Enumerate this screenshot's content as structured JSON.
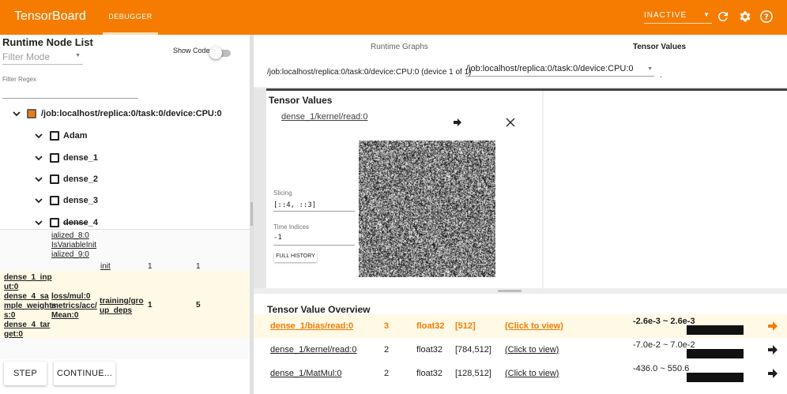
{
  "header": {
    "brand": "TensorBoard",
    "tab": "DEBUGGER",
    "status": "INACTIVE"
  },
  "left": {
    "title": "Runtime Node List",
    "filter_mode_placeholder": "Filter Mode",
    "show_code_label": "Show Code:",
    "filter_regex_label": "Filter Regex",
    "device_node": "/job:localhost/replica:0/task:0/device:CPU:0",
    "nodes": [
      "Adam",
      "dense_1",
      "dense_2",
      "dense_3",
      "dense_4"
    ],
    "partial_lines": [
      "ialized_8:0",
      "IsVariableInit",
      "ialized_9:0"
    ],
    "row_init": {
      "name": "init",
      "c1": "1",
      "c2": "1"
    },
    "row_training": {
      "inputs": [
        "dense_1_inp",
        "ut:0",
        "dense_4_sa",
        "mple_weights",
        "s:0",
        "dense_4_tar",
        "get:0"
      ],
      "loss": [
        "loss/mul:0",
        "metrics/acc/",
        "Mean:0"
      ],
      "name": [
        "training/gro",
        "up_deps"
      ],
      "c1": "1",
      "c2": "5"
    },
    "step_button": "STEP",
    "continue_button": "CONTINUE..."
  },
  "runtime": {
    "tab_graphs": "Runtime Graphs",
    "tab_values": "Tensor Values",
    "device_text": "/job:localhost/replica:0/task:0/device:CPU:0 (device 1 of 1)",
    "device_select": "/job:localhost/replica:0/task:0/device:CPU:0",
    "device_dot": "."
  },
  "tensor_values": {
    "title": "Tensor Values",
    "tensor": "dense_1/kernel/read:0",
    "slicing_label": "Slicing",
    "slicing_value": "[::4, ::3]",
    "time_label": "Time Indices",
    "time_value": "-1",
    "full_history": "FULL HISTORY"
  },
  "overview": {
    "title": "Tensor Value Overview",
    "rows": [
      {
        "name": "dense_1/bias/read:0",
        "count": "3",
        "dtype": "float32",
        "shape": "[512]",
        "link": "(Click to view)",
        "range": "-2.6e-3 ~ 2.6e-3"
      },
      {
        "name": "dense_1/kernel/read:0",
        "count": "2",
        "dtype": "float32",
        "shape": "[784,512]",
        "link": "(Click to view)",
        "range": "-7.0e-2 ~ 7.0e-2"
      },
      {
        "name": "dense_1/MatMul:0",
        "count": "2",
        "dtype": "float32",
        "shape": "[128,512]",
        "link": "(Click to view)",
        "range": "-436.0 ~ 550.6"
      }
    ]
  },
  "colors": {
    "accent": "#f57c00",
    "highlight_row": "#fff9e6",
    "divider": "#424242"
  },
  "icons": [
    "refresh-icon",
    "gear-icon",
    "help-icon",
    "chevron-down-icon",
    "arrow-right-icon",
    "close-icon"
  ]
}
